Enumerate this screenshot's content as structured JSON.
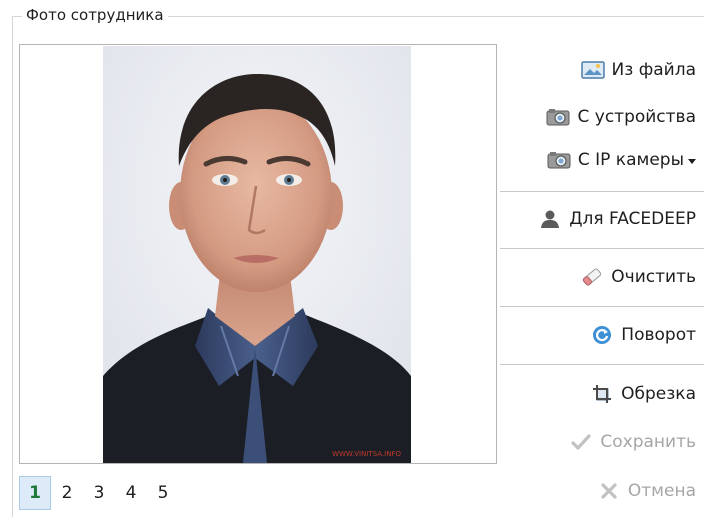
{
  "group": {
    "title": "Фото сотрудника"
  },
  "photo": {
    "watermark": "WWW.VINITSA.INFO"
  },
  "pager": {
    "pages": [
      "1",
      "2",
      "3",
      "4",
      "5"
    ],
    "active": "1"
  },
  "actions": {
    "from_file": {
      "label": "Из файла",
      "icon": "image-file-icon"
    },
    "from_device": {
      "label": "С устройства",
      "icon": "camera-icon"
    },
    "from_ip_camera": {
      "label": "С IP камеры",
      "icon": "camera-icon"
    },
    "for_facedeep": {
      "label": "Для FACEDEEP",
      "icon": "person-icon"
    },
    "clear": {
      "label": "Очистить",
      "icon": "eraser-icon"
    },
    "rotate": {
      "label": "Поворот",
      "icon": "rotate-icon"
    },
    "crop": {
      "label": "Обрезка",
      "icon": "crop-icon"
    },
    "save": {
      "label": "Сохранить",
      "icon": "checkmark-icon",
      "enabled": false
    },
    "cancel": {
      "label": "Отмена",
      "icon": "close-icon",
      "enabled": false
    }
  },
  "colors": {
    "active_page_bg": "#dcebf7",
    "active_page_text": "#1f7a38",
    "disabled_text": "#a6a6a6"
  }
}
